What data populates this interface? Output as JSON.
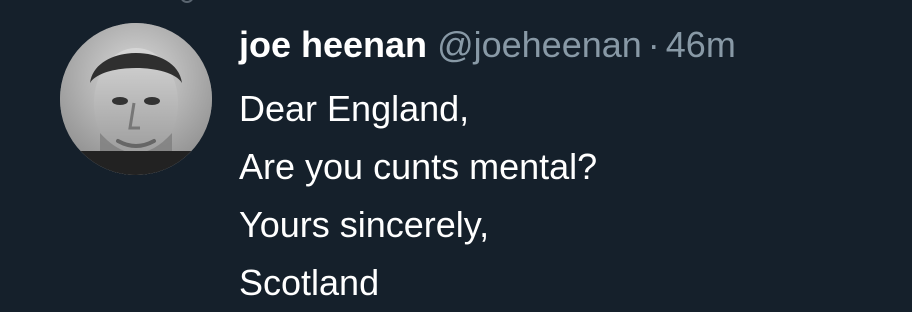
{
  "tweet": {
    "display_name": "joe heenan",
    "handle": "@joeheenan",
    "separator": "·",
    "timestamp": "46m",
    "lines": [
      "Dear England,",
      "Are you cunts mental?",
      "Yours sincerely,",
      "Scotland"
    ]
  },
  "icons": {
    "avatar": "profile-photo",
    "top_fragment": "reply-arc-fragment"
  },
  "colors": {
    "background": "#15202b",
    "name": "#ffffff",
    "secondary": "#8899a6",
    "text": "#ffffff"
  }
}
